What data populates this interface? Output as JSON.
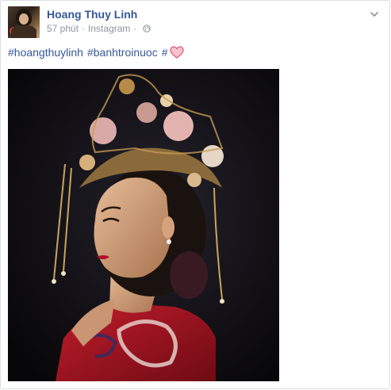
{
  "post": {
    "author": "Hoang Thuy Linh",
    "time": "57 phút",
    "separator": "·",
    "source": "Instagram",
    "hashtags": [
      "#hoangthuylinh",
      "#banhtroinuoc",
      "#"
    ],
    "privacy_icon": "globe-icon",
    "emoji_icon": "heart-icon",
    "emoji_color": "#f39bb0",
    "menu_icon": "chevron-down-icon"
  },
  "colors": {
    "link": "#365899",
    "meta": "#90949c",
    "text": "#1d2129",
    "border": "#dddfe2"
  }
}
